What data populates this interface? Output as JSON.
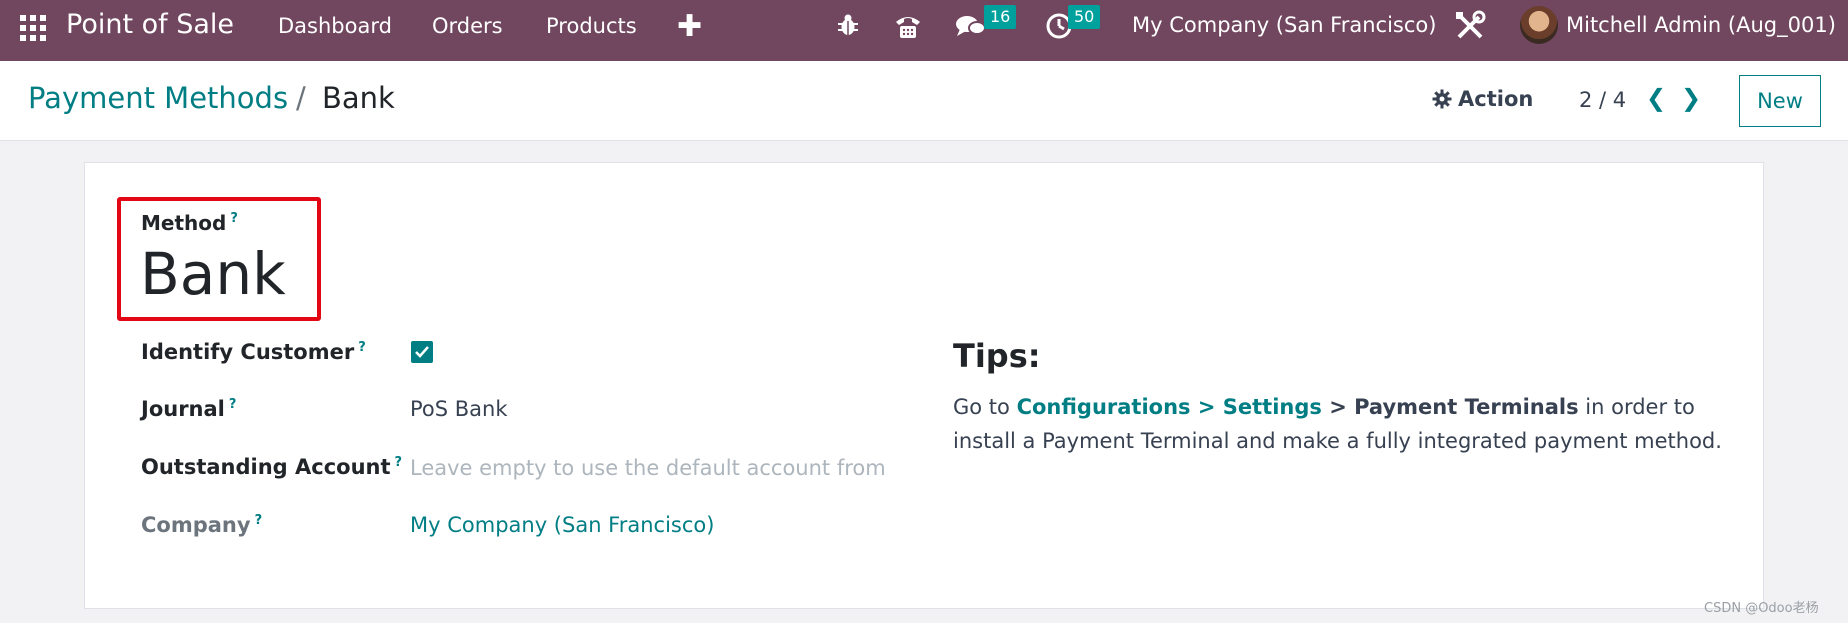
{
  "navbar": {
    "brand": "Point of Sale",
    "menus": [
      "Dashboard",
      "Orders",
      "Products"
    ],
    "plus": "✚",
    "messages_count": "16",
    "activities_count": "50",
    "company": "My Company (San Francisco)",
    "user": "Mitchell Admin (Aug_001)"
  },
  "control_panel": {
    "breadcrumb_parent": "Payment Methods",
    "breadcrumb_sep": "/",
    "breadcrumb_current": "Bank",
    "action_label": "Action",
    "pager": "2 / 4",
    "prev": "❮",
    "next": "❯",
    "new_label": "New"
  },
  "form": {
    "method_label": "Method",
    "method_value": "Bank",
    "help_mark": "?",
    "identify_customer_label": "Identify Customer",
    "identify_customer_checked": true,
    "journal_label": "Journal",
    "journal_value": "PoS Bank",
    "outstanding_label": "Outstanding Account",
    "outstanding_placeholder": "Leave empty to use the default account from",
    "company_label": "Company",
    "company_value": "My Company (San Francisco)"
  },
  "tips": {
    "title": "Tips:",
    "prefix": "Go to ",
    "config_link": "Configurations > Settings",
    "sep": " > ",
    "terminals": "Payment Terminals",
    "suffix": " in order to install a Payment Terminal and make a fully integrated payment method."
  },
  "watermark": "CSDN @Odoo老杨",
  "colors": {
    "navbar": "#71465f",
    "accent": "#017e84",
    "badge": "#00a09d",
    "highlight": "#e30613"
  }
}
